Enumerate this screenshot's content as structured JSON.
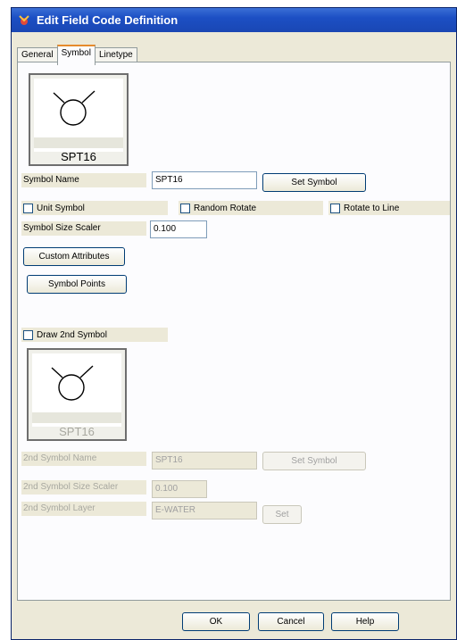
{
  "window": {
    "title": "Edit Field Code Definition",
    "icon": "app-icon"
  },
  "tabs": [
    {
      "label": "General",
      "active": false
    },
    {
      "label": "Symbol",
      "active": true
    },
    {
      "label": "Linetype",
      "active": false
    }
  ],
  "symbol": {
    "preview_caption": "SPT16",
    "name_label": "Symbol Name",
    "name_value": "SPT16",
    "set_symbol_label": "Set Symbol",
    "unit_symbol_label": "Unit Symbol",
    "unit_symbol_checked": false,
    "random_rotate_label": "Random Rotate",
    "random_rotate_checked": false,
    "rotate_to_line_label": "Rotate to Line",
    "rotate_to_line_checked": false,
    "size_scaler_label": "Symbol Size Scaler",
    "size_scaler_value": "0.100",
    "custom_attributes_label": "Custom Attributes",
    "symbol_points_label": "Symbol Points"
  },
  "second_symbol": {
    "draw_label": "Draw 2nd Symbol",
    "draw_checked": false,
    "preview_caption": "SPT16",
    "name_label": "2nd Symbol Name",
    "name_value": "SPT16",
    "set_symbol_label": "Set Symbol",
    "size_scaler_label": "2nd Symbol Size Scaler",
    "size_scaler_value": "0.100",
    "layer_label": "2nd Symbol Layer",
    "layer_value": "E-WATER",
    "set_label": "Set"
  },
  "footer": {
    "ok_label": "OK",
    "cancel_label": "Cancel",
    "help_label": "Help"
  }
}
